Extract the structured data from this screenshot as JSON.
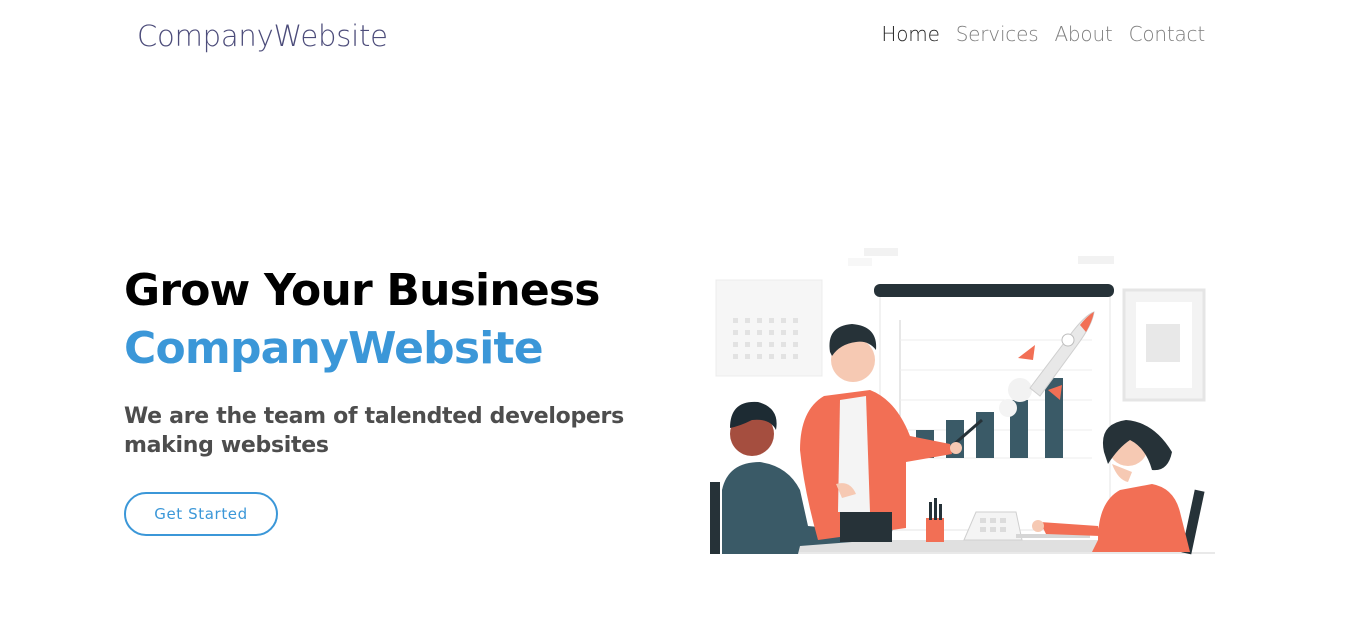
{
  "brand": "CompanyWebsite",
  "nav": {
    "items": [
      {
        "label": "Home",
        "active": true
      },
      {
        "label": "Services",
        "active": false
      },
      {
        "label": "About",
        "active": false
      },
      {
        "label": "Contact",
        "active": false
      }
    ]
  },
  "hero": {
    "title": "Grow Your Business",
    "brand_highlight": "CompanyWebsite",
    "subtitle": "We are the team of talendted developers making websites",
    "cta_label": "Get Started"
  },
  "colors": {
    "accent": "#3b97d8",
    "brand_text": "#4c4c7a",
    "illustration_orange": "#f26f55",
    "illustration_dark": "#263238",
    "illustration_slate": "#3a5a67"
  },
  "illustration": {
    "icon": "business-growth-illustration"
  }
}
